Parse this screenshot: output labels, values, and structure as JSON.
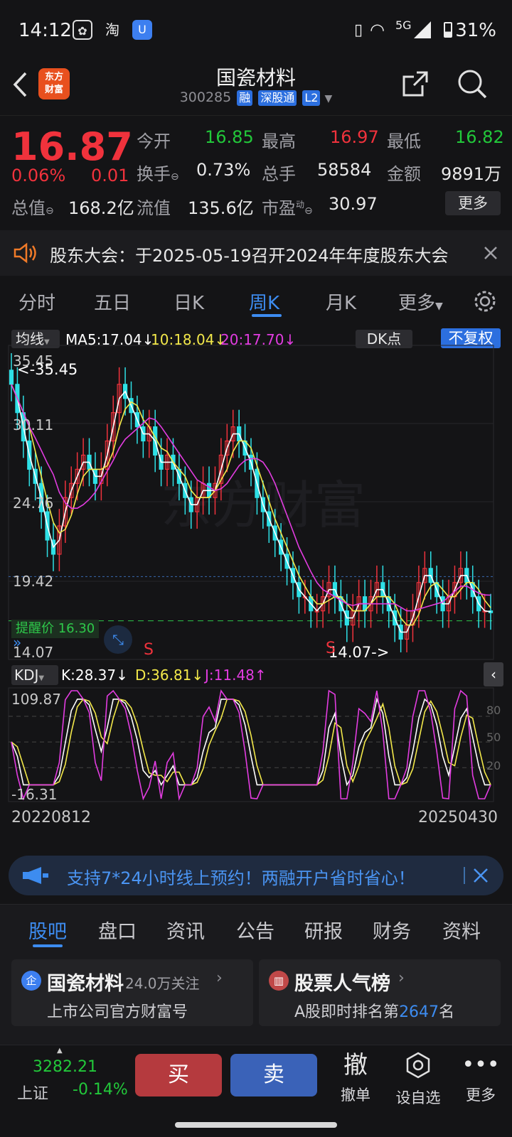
{
  "status_bar": {
    "time": "14:12",
    "network": "5G",
    "battery": "31%",
    "app_icon_taobao": "淘"
  },
  "header": {
    "title": "国瓷材料",
    "code": "300285",
    "tags": [
      "融",
      "深股通",
      "L2"
    ],
    "logo_text": "东方财富"
  },
  "quote": {
    "price": "16.87",
    "change_pct": "0.06%",
    "change": "0.01",
    "open_label": "今开",
    "open": "16.85",
    "high_label": "最高",
    "high": "16.97",
    "low_label": "最低",
    "low": "16.82",
    "turnover_label": "换手",
    "turnover": "0.73%",
    "volume_label": "总手",
    "volume": "58584",
    "amount_label": "金额",
    "amount": "9891万",
    "mktcap_label": "总值",
    "mktcap": "168.2亿",
    "float_label": "流值",
    "float": "135.6亿",
    "pe_label": "市盈",
    "pe_sup": "动",
    "pe": "30.97",
    "more": "更多"
  },
  "notice": {
    "text": "股东大会：于2025-05-19召开2024年年度股东大会"
  },
  "ktabs": {
    "items": [
      "分时",
      "五日",
      "日K",
      "周K",
      "月K",
      "更多"
    ],
    "active": 3
  },
  "chart": {
    "ma_selector": "均线",
    "ma5": "MA5:17.04↓",
    "ma10": "10:18.04↓",
    "ma20": "20:17.70↓",
    "dk": "DK点",
    "fq": "不复权",
    "price_ticks": [
      "35.45",
      "30.11",
      "24.76",
      "19.42",
      "14.07"
    ],
    "max_mark": "<-35.45",
    "min_mark": "14.07->",
    "alert": "提醒价 16.30",
    "s_marks": [
      "S",
      "S"
    ],
    "kdj_selector": "KDJ",
    "k": "K:28.37↓",
    "d": "D:36.81↓",
    "j": "J:11.48↑",
    "kdj_ticks": [
      "109.87",
      "-16.31"
    ],
    "kdj_right": [
      "80",
      "50",
      "20"
    ],
    "date_start": "20220812",
    "date_end": "20250430",
    "watermark": "东方财富",
    "colors": {
      "up": "#f0323c",
      "down": "#2ee0e6",
      "ma5": "#ffffff",
      "ma10": "#f2e84a",
      "ma20": "#e23ce0"
    }
  },
  "chart_data": {
    "type": "candlestick",
    "period": "weekly",
    "ylim": [
      14.07,
      35.45
    ],
    "close_series": [
      33,
      31,
      29,
      27,
      26,
      24,
      22,
      21,
      23,
      25,
      26,
      27,
      28,
      27,
      26,
      27,
      29,
      31,
      33,
      32,
      31,
      30,
      29,
      30,
      28,
      27,
      28,
      27,
      26,
      25,
      24,
      25,
      26,
      25,
      26,
      28,
      29,
      30,
      29,
      28,
      27,
      25,
      24,
      23,
      22,
      21,
      20,
      19,
      18,
      18,
      17,
      17,
      18,
      19,
      18,
      17,
      16,
      17,
      18,
      17,
      18,
      19,
      18,
      17,
      16,
      15,
      16,
      17,
      19,
      20,
      19,
      18,
      17,
      18,
      19,
      20,
      19,
      18,
      17,
      17,
      16.87
    ],
    "kdj_range": [
      -16.31,
      109.87
    ]
  },
  "banner": {
    "text": "支持7*24小时线上预约！两融开户省时省心！"
  },
  "btabs": {
    "items": [
      "股吧",
      "盘口",
      "资讯",
      "公告",
      "研报",
      "财务",
      "资料"
    ],
    "active": 0
  },
  "cards": [
    {
      "title": "国瓷材料",
      "meta": "24.0万关注",
      "sub": "上市公司官方财富号"
    },
    {
      "title": "股票人气榜",
      "sub_prefix": "A股即时排名第",
      "rank": "2647",
      "sub_suffix": "名"
    }
  ],
  "bottom": {
    "index_value": "3282.21",
    "index_name": "上证",
    "index_change": "-0.14%",
    "buy": "买",
    "sell": "卖",
    "cancel_icon": "撤",
    "cancel": "撤单",
    "watch": "设自选",
    "more": "更多"
  }
}
